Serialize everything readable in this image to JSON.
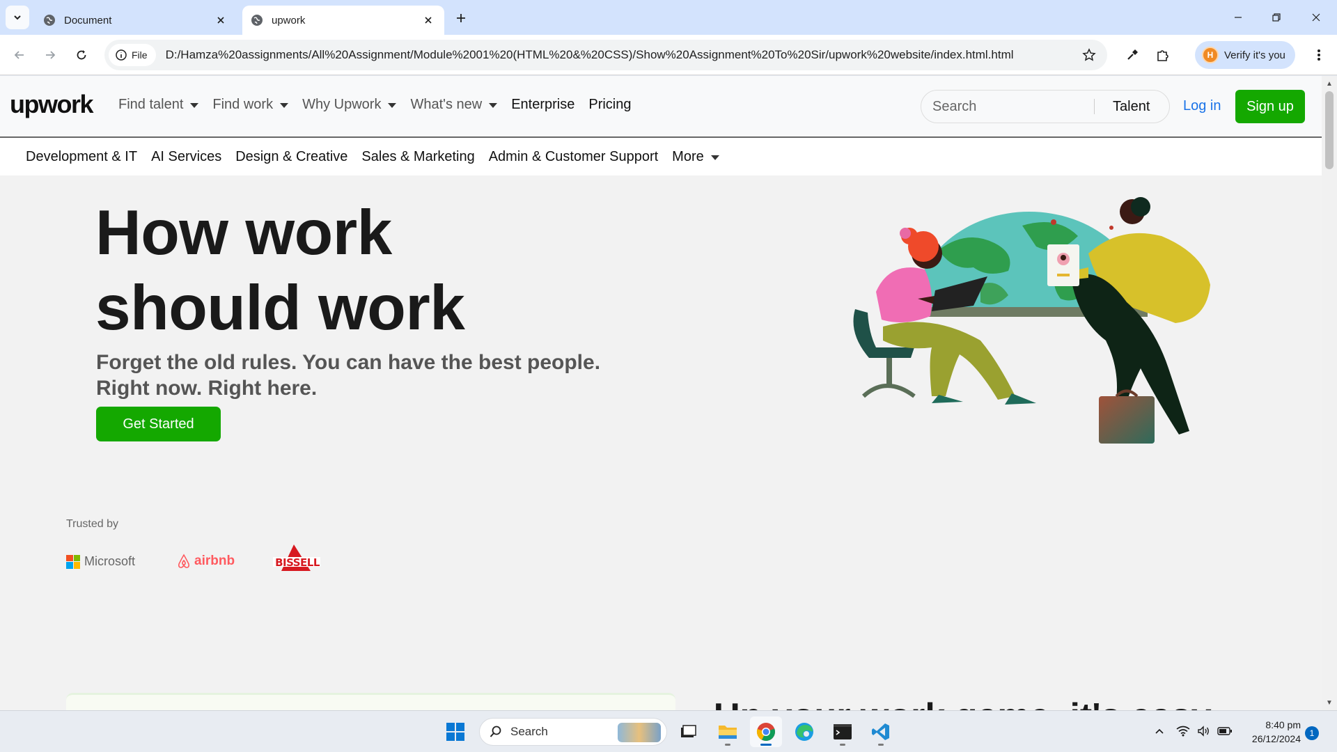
{
  "browser": {
    "tabs": [
      {
        "title": "Document",
        "active": false
      },
      {
        "title": "upwork",
        "active": true
      }
    ],
    "omnibox": {
      "scheme_chip": "File",
      "url": "D:/Hamza%20assignments/All%20Assignment/Module%2001%20(HTML%20&%20CSS)/Show%20Assignment%20To%20Sir/upwork%20website/index.html.html"
    },
    "profile_button": "Verify it's you",
    "profile_initial": "H"
  },
  "site": {
    "logo": {
      "part1": "up",
      "part2": "work"
    },
    "nav": [
      {
        "label": "Find talent",
        "dropdown": true
      },
      {
        "label": "Find work",
        "dropdown": true
      },
      {
        "label": "Why Upwork",
        "dropdown": true
      },
      {
        "label": "What's new",
        "dropdown": true
      },
      {
        "label": "Enterprise",
        "dropdown": false
      },
      {
        "label": "Pricing",
        "dropdown": false
      }
    ],
    "search": {
      "placeholder": "Search",
      "scope": "Talent"
    },
    "login": "Log in",
    "signup": "Sign up",
    "categories": [
      {
        "label": "Development & IT"
      },
      {
        "label": "AI Services"
      },
      {
        "label": "Design & Creative"
      },
      {
        "label": "Sales & Marketing"
      },
      {
        "label": "Admin & Customer Support"
      },
      {
        "label": "More",
        "dropdown": true
      }
    ],
    "hero": {
      "line1": "How work",
      "line2": "should work",
      "sub1": "Forget the old rules. You can have the best people.",
      "sub2": "Right now. Right here.",
      "cta": "Get Started"
    },
    "trusted": {
      "label": "Trusted by",
      "brands": [
        "Microsoft",
        "airbnb",
        "BISSELL"
      ]
    },
    "next_section_heading": "Up your work game, it's easy"
  },
  "taskbar": {
    "search_label": "Search",
    "time": "8:40 pm",
    "date": "26/12/2024",
    "notification_count": "1"
  },
  "colors": {
    "brand_green": "#14a800",
    "link_blue": "#1a73e8",
    "tabstrip": "#d3e3fd"
  }
}
